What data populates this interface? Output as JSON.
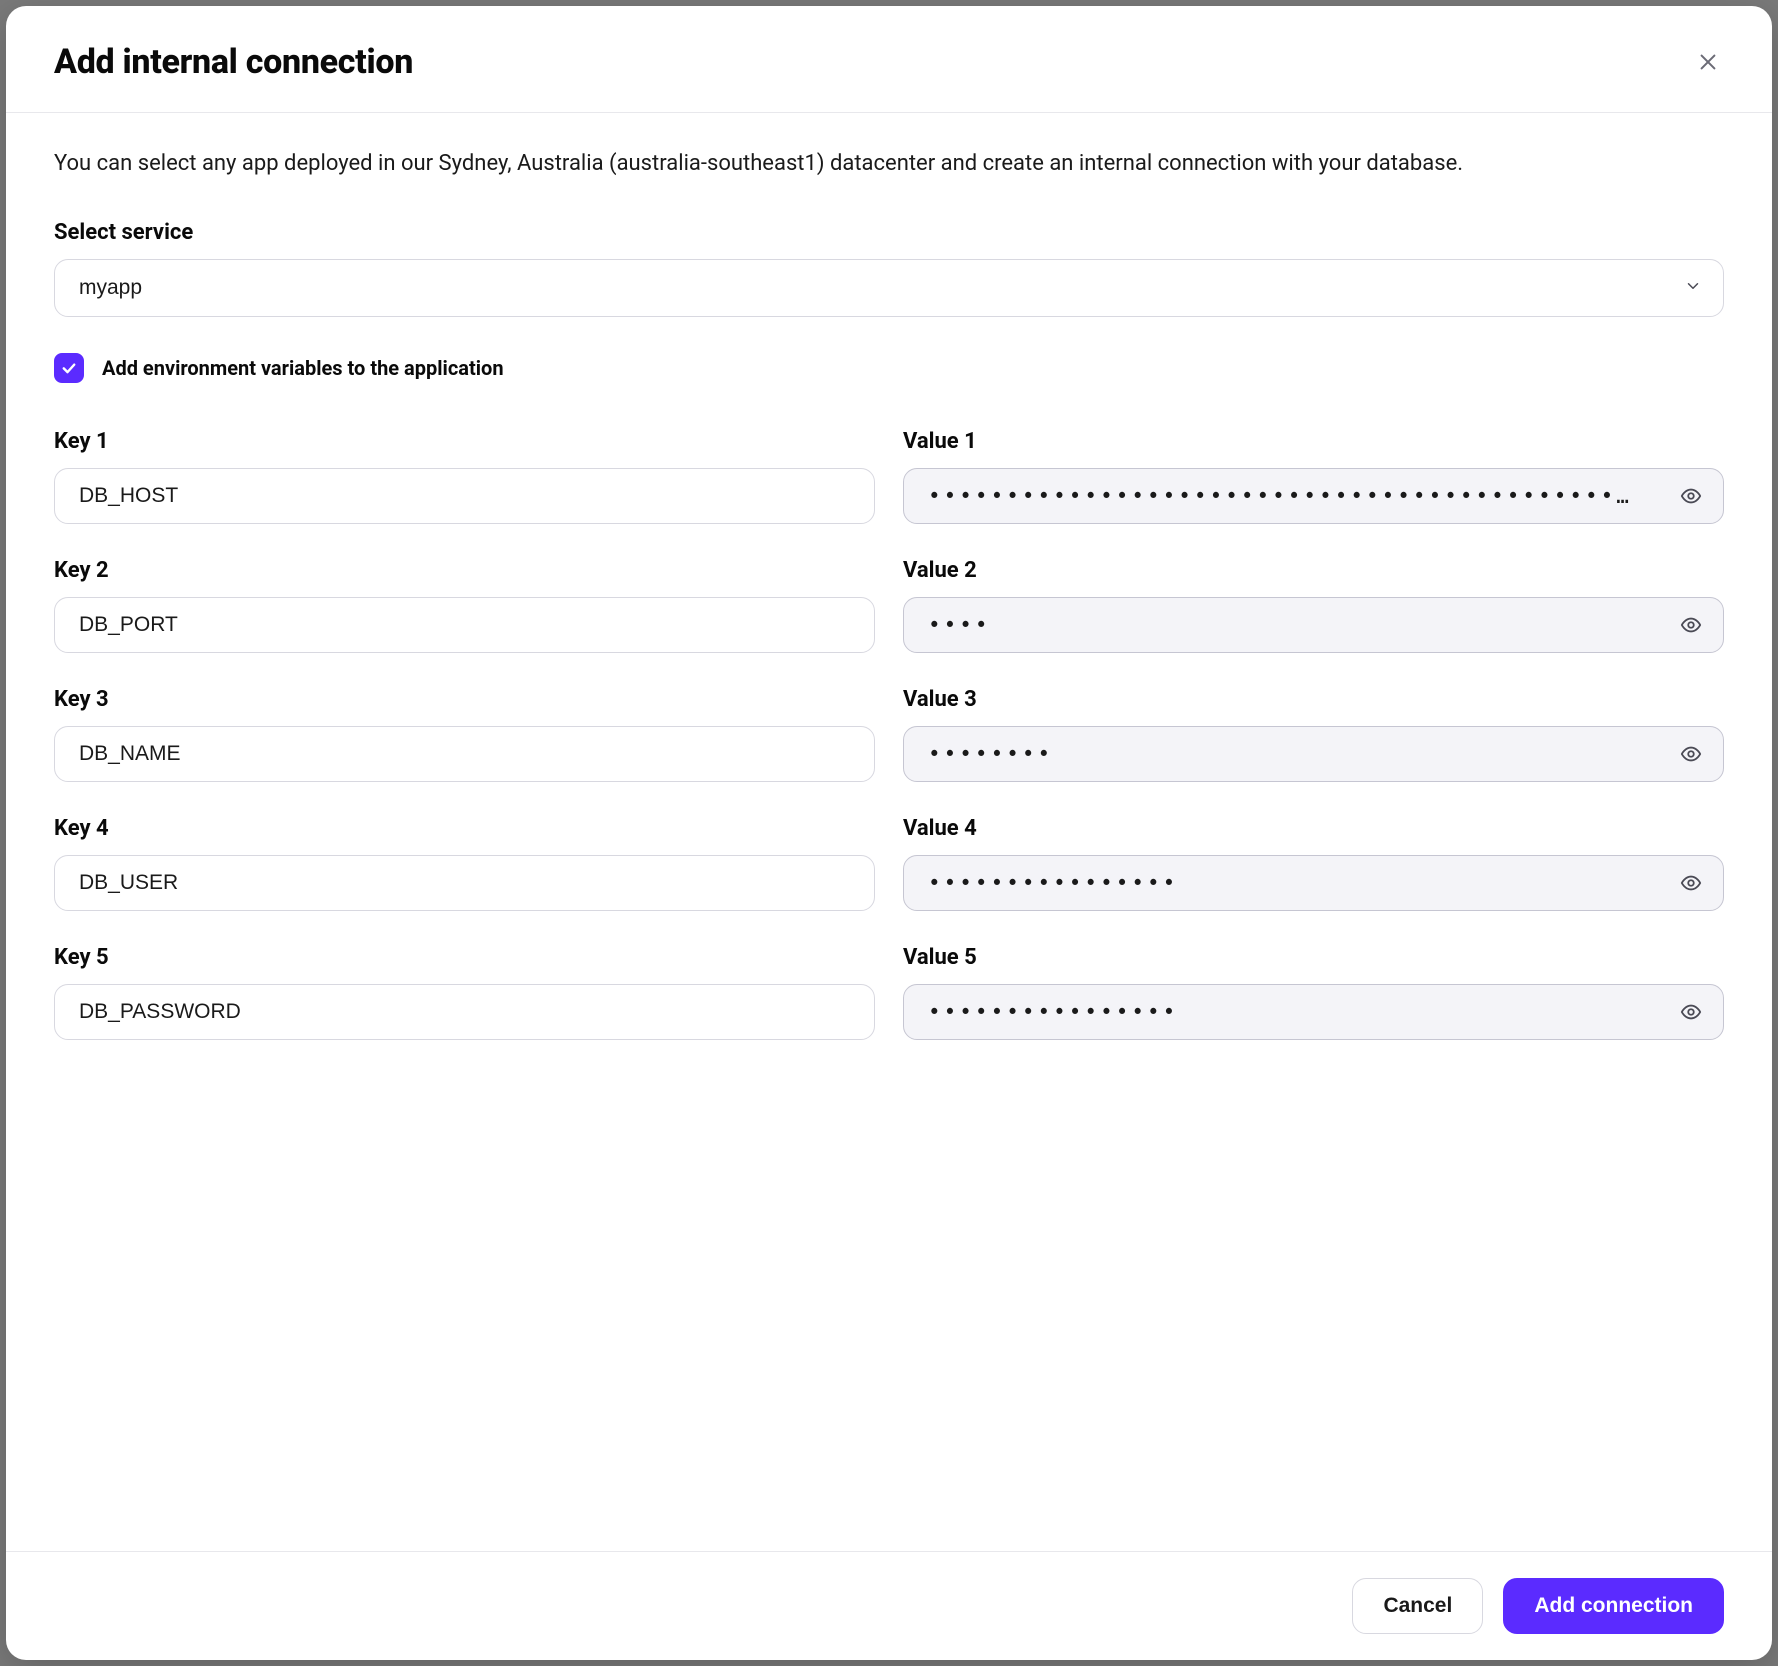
{
  "modal": {
    "title": "Add internal connection",
    "description": "You can select any app deployed in our Sydney, Australia (australia-southeast1) datacenter and create an internal connection with your database."
  },
  "service": {
    "label": "Select service",
    "selected": "myapp"
  },
  "checkbox": {
    "label": "Add environment variables to the application",
    "checked": true
  },
  "kv": [
    {
      "keyLabel": "Key 1",
      "valueLabel": "Value 1",
      "key": "DB_HOST",
      "value": "••••••••••••••••••••••••••••••••••••••••••••…"
    },
    {
      "keyLabel": "Key 2",
      "valueLabel": "Value 2",
      "key": "DB_PORT",
      "value": "••••"
    },
    {
      "keyLabel": "Key 3",
      "valueLabel": "Value 3",
      "key": "DB_NAME",
      "value": "••••••••"
    },
    {
      "keyLabel": "Key 4",
      "valueLabel": "Value 4",
      "key": "DB_USER",
      "value": "••••••••••••••••"
    },
    {
      "keyLabel": "Key 5",
      "valueLabel": "Value 5",
      "key": "DB_PASSWORD",
      "value": "••••••••••••••••"
    }
  ],
  "footer": {
    "cancel": "Cancel",
    "submit": "Add connection"
  }
}
